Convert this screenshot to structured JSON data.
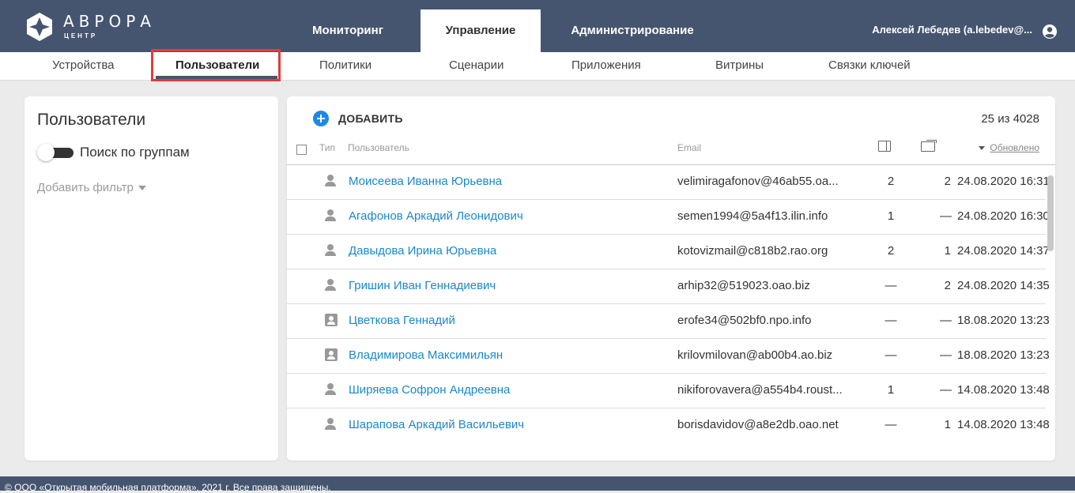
{
  "brand": {
    "name": "АВРОРА",
    "sub": "ЦЕНТР"
  },
  "main_tabs": [
    {
      "label": "Мониторинг",
      "active": false
    },
    {
      "label": "Управление",
      "active": true
    },
    {
      "label": "Администрирование",
      "active": false
    }
  ],
  "user": {
    "display": "Алексей Лебедев (a.lebedev@..."
  },
  "sub_tabs": [
    {
      "label": "Устройства",
      "active": false
    },
    {
      "label": "Пользователи",
      "active": true
    },
    {
      "label": "Политики",
      "active": false
    },
    {
      "label": "Сценарии",
      "active": false
    },
    {
      "label": "Приложения",
      "active": false
    },
    {
      "label": "Витрины",
      "active": false
    },
    {
      "label": "Связки ключей",
      "active": false
    }
  ],
  "filters": {
    "title": "Пользователи",
    "group_search_label": "Поиск по группам",
    "group_search_enabled": false,
    "add_filter_label": "Добавить фильтр"
  },
  "list": {
    "add_label": "ДОБАВИТЬ",
    "count_label": "25 из 4028",
    "columns": {
      "type": "Тип",
      "user": "Пользователь",
      "email": "Email",
      "updated": "Обновлено"
    },
    "rows": [
      {
        "type": "person",
        "name": "Моисеева Иванна Юрьевна",
        "email": "velimiragafonov@46ab55.oa...",
        "c1": "2",
        "c2": "2",
        "updated": "24.08.2020 16:31"
      },
      {
        "type": "person",
        "name": "Агафонов Аркадий Леонидович",
        "email": "semen1994@5a4f13.ilin.info",
        "c1": "1",
        "c2": "—",
        "updated": "24.08.2020 16:30"
      },
      {
        "type": "person",
        "name": "Давыдова Ирина Юрьевна",
        "email": "kotovizmail@c818b2.rao.org",
        "c1": "2",
        "c2": "1",
        "updated": "24.08.2020 14:37"
      },
      {
        "type": "person",
        "name": "Гришин Иван Геннадиевич",
        "email": "arhip32@519023.oao.biz",
        "c1": "—",
        "c2": "2",
        "updated": "24.08.2020 14:35"
      },
      {
        "type": "contact",
        "name": "Цветкова Геннадий",
        "email": "erofe34@502bf0.npo.info",
        "c1": "—",
        "c2": "—",
        "updated": "18.08.2020 13:23"
      },
      {
        "type": "contact",
        "name": "Владимирова Максимильян",
        "email": "krilovmilovan@ab00b4.ao.biz",
        "c1": "—",
        "c2": "—",
        "updated": "18.08.2020 13:23"
      },
      {
        "type": "person",
        "name": "Ширяева Софрон Андреевна",
        "email": "nikiforovavera@a554b4.roust...",
        "c1": "1",
        "c2": "—",
        "updated": "14.08.2020 13:48"
      },
      {
        "type": "person",
        "name": "Шарапова Аркадий Васильевич",
        "email": "borisdavidov@a8e2db.oao.net",
        "c1": "—",
        "c2": "1",
        "updated": "14.08.2020 13:48"
      }
    ]
  },
  "footer": {
    "text": "© ООО «Открытая мобильная платформа», 2021 г. Все права защищены."
  },
  "colors": {
    "header_bg": "#46556f",
    "link": "#1a88c9",
    "accent": "#1e88e5",
    "highlight": "#e23b3b"
  }
}
